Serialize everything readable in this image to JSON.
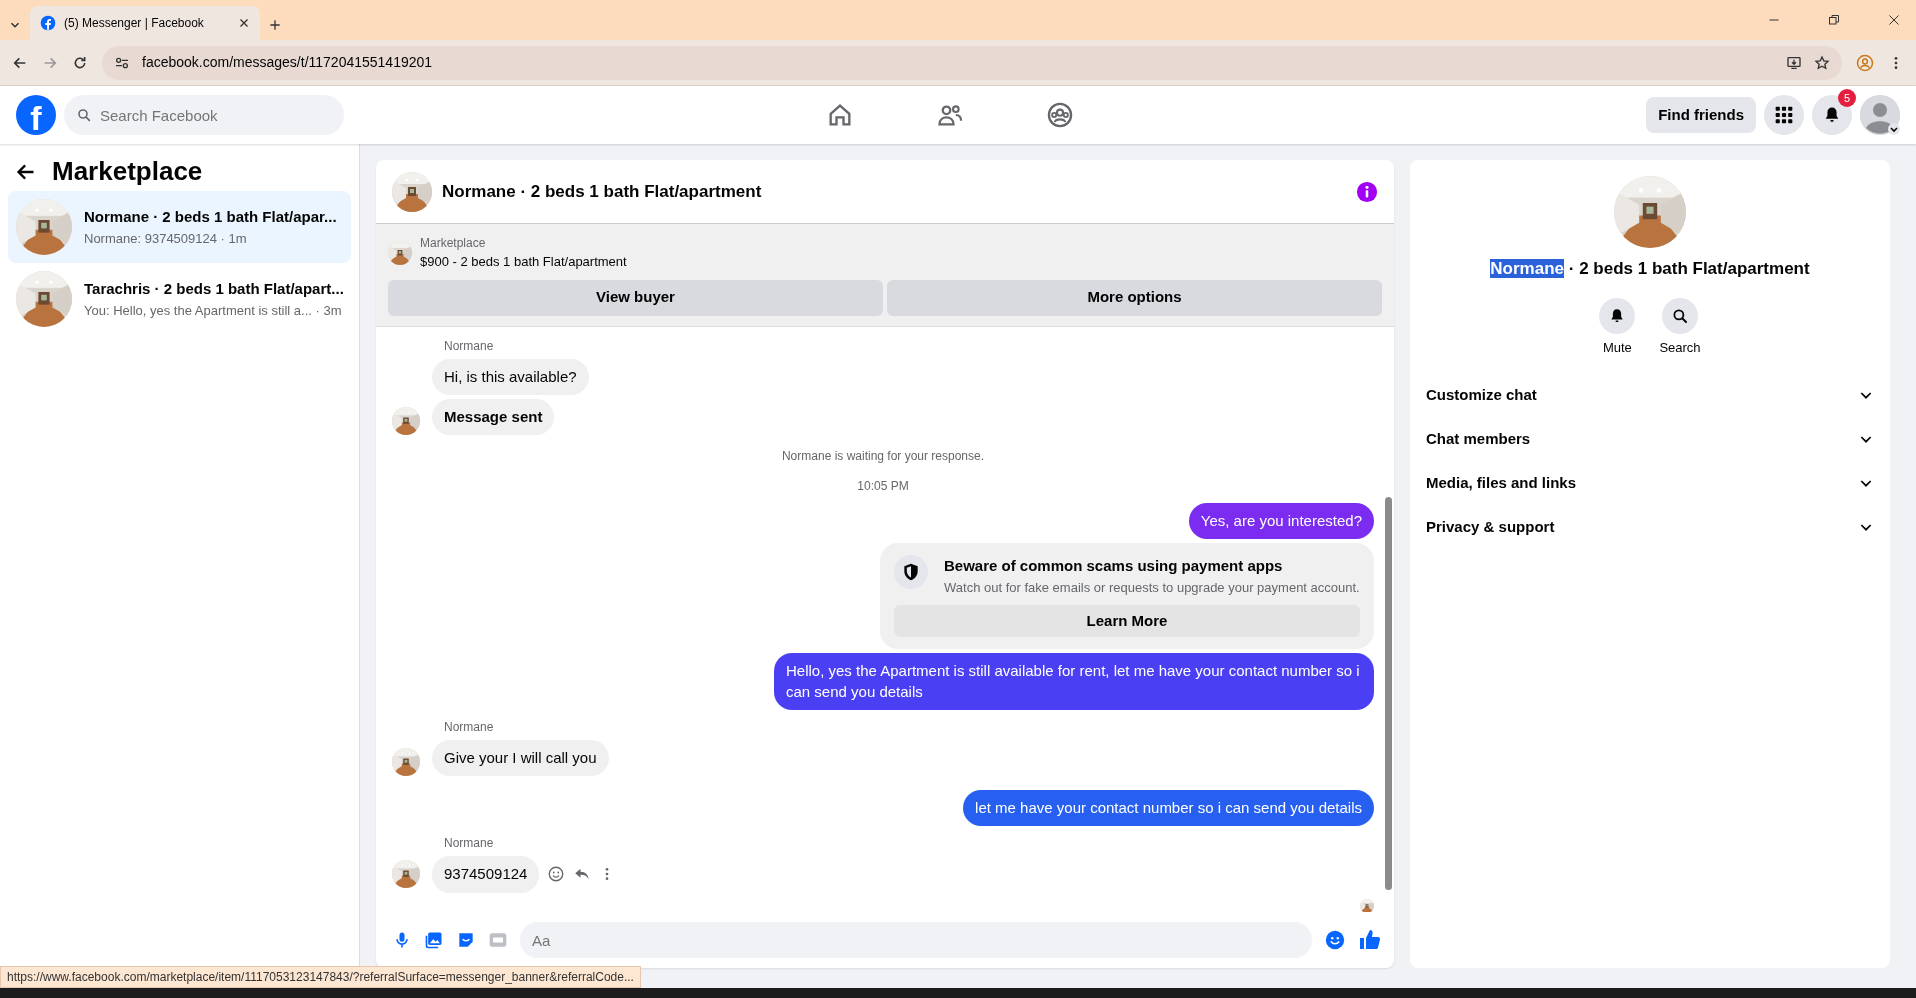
{
  "browser": {
    "tab_title": "(5) Messenger | Facebook",
    "url": "facebook.com/messages/t/1172041551419201",
    "status_url": "https://www.facebook.com/marketplace/item/1117053123147843/?referralSurface=messenger_banner&referralCode..."
  },
  "header": {
    "logo": "f",
    "search": {
      "placeholder": "Search Facebook"
    },
    "nav": [
      {
        "selected": false
      },
      {
        "selected": false
      },
      {
        "selected": false
      }
    ],
    "find_friends": "Find friends",
    "notifications": "5"
  },
  "sidebar": {
    "title": "Marketplace",
    "conversations": [
      {
        "title": "Normane · 2 beds 1 bath Flat/apar...",
        "preview": "Normane: 9374509124 · 1m",
        "selected": true
      },
      {
        "title": "Tarachris · 2 beds 1 bath Flat/apart...",
        "preview": "You: Hello, yes the Apartment is still a... · 3m",
        "selected": false
      }
    ]
  },
  "chat": {
    "title": "Normane · 2 beds 1 bath Flat/apartment",
    "banner": {
      "label": "Marketplace",
      "listing": "$900 - 2 beds 1 bath Flat/apartment",
      "buttons": [
        "View buyer",
        "More options"
      ]
    },
    "messages": [
      {
        "kind": "incoming",
        "sender": "Normane",
        "text": "Hi, is this available?",
        "avatar": false
      },
      {
        "kind": "incoming",
        "text": "Message sent",
        "avatar": true,
        "bold": true
      },
      {
        "kind": "notice",
        "text": "Normane is waiting for your response."
      },
      {
        "kind": "time",
        "text": "10:05 PM"
      },
      {
        "kind": "outgoing",
        "text": "Yes, are you interested?",
        "color": "#7b2cf0"
      },
      {
        "kind": "warning",
        "title": "Beware of common scams using payment apps",
        "text": "Watch out for fake emails or requests to upgrade your payment account.",
        "button": "Learn More"
      },
      {
        "kind": "outgoing",
        "text": "Hello, yes the Apartment is still available for rent, let me have your contact number so i can send you details",
        "color": "#4a3ff2"
      },
      {
        "kind": "incoming",
        "sender": "Normane",
        "text": "Give your I will call you",
        "avatar": true
      },
      {
        "kind": "outgoing",
        "text": "let me have your contact number so i can send you details",
        "color": "#2760f0"
      },
      {
        "kind": "incoming",
        "sender": "Normane",
        "text": "9374509124",
        "avatar": true,
        "actions": true
      }
    ],
    "composer": {
      "placeholder": "Aa"
    }
  },
  "details": {
    "name": "Normane",
    "name_selected": true,
    "rest": "· 2 beds 1 bath Flat/apartment",
    "actions": [
      {
        "label": "Mute"
      },
      {
        "label": "Search"
      }
    ],
    "sections": [
      {
        "label": "Customize chat",
        "expanded": false
      },
      {
        "label": "Chat members",
        "expanded": false
      },
      {
        "label": "Media, files and links",
        "expanded": false
      },
      {
        "label": "Privacy & support",
        "expanded": false
      }
    ]
  }
}
